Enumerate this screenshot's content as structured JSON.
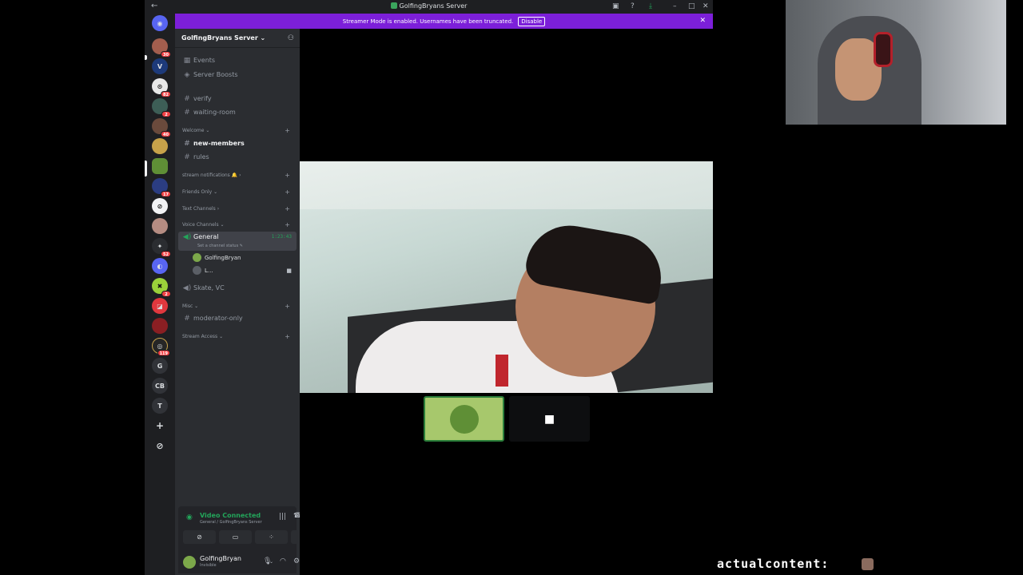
{
  "window": {
    "title": "GolfingBryans Server",
    "back_glyph": "←",
    "icons": [
      "screen-icon",
      "help-icon",
      "download-icon",
      "minimize-icon",
      "maximize-icon",
      "close-icon"
    ]
  },
  "streamer_banner": {
    "text": "Streamer Mode is enabled. Usernames have been truncated.",
    "button": "Disable",
    "close": "✕",
    "color": "#7c1fd9"
  },
  "rail": {
    "servers": [
      {
        "label": "",
        "badge": "30"
      },
      {
        "label": "",
        "badge": ""
      },
      {
        "label": "",
        "badge": "82"
      },
      {
        "label": "",
        "badge": "2"
      },
      {
        "label": "",
        "badge": "40"
      },
      {
        "label": "",
        "badge": ""
      },
      {
        "label": "",
        "badge": ""
      },
      {
        "label": "",
        "badge": "17"
      },
      {
        "label": "",
        "badge": ""
      },
      {
        "label": "",
        "badge": ""
      },
      {
        "label": "",
        "badge": "52"
      },
      {
        "label": "",
        "badge": ""
      },
      {
        "label": "",
        "badge": "2"
      },
      {
        "label": "",
        "badge": ""
      },
      {
        "label": "",
        "badge": ""
      },
      {
        "label": "",
        "badge": "119"
      },
      {
        "label": "G",
        "badge": ""
      },
      {
        "label": "CB",
        "badge": ""
      },
      {
        "label": "T",
        "badge": ""
      },
      {
        "label": "+",
        "badge": ""
      },
      {
        "label": "⊘",
        "badge": ""
      }
    ]
  },
  "sidebar": {
    "server_name": "GolfingBryans Server ⌄",
    "top_items": [
      {
        "icon": "calendar-icon",
        "label": "Events"
      },
      {
        "icon": "boost-icon",
        "label": "Server Boosts"
      }
    ],
    "channels_top": [
      "verify",
      "waiting-room"
    ],
    "categories": {
      "welcome": "Welcome ⌄",
      "stream_notifications": "stream notifications 🔔 ›",
      "friends_only": "Friends Only ⌄",
      "text_channels": "Text Channels ›",
      "voice_channels": "Voice Channels ⌄",
      "misc": "Misc ⌄",
      "stream_access": "Stream Access ⌄"
    },
    "welcome_channels": [
      "new-members",
      "rules"
    ],
    "voice": {
      "general": "General",
      "timer": "1:23:43",
      "status": "Set a channel status ✎",
      "members": [
        "GolfingBryan",
        "L..."
      ],
      "skate": "Skate, VC"
    },
    "misc_channels": [
      "moderator-only"
    ]
  },
  "voice_panel": {
    "title": "Video Connected",
    "subtitle": "General / GolfingBryans Server"
  },
  "user_panel": {
    "name": "GolfingBryan",
    "status": "Invisible"
  },
  "overlay": {
    "name": "actualcontent:"
  }
}
